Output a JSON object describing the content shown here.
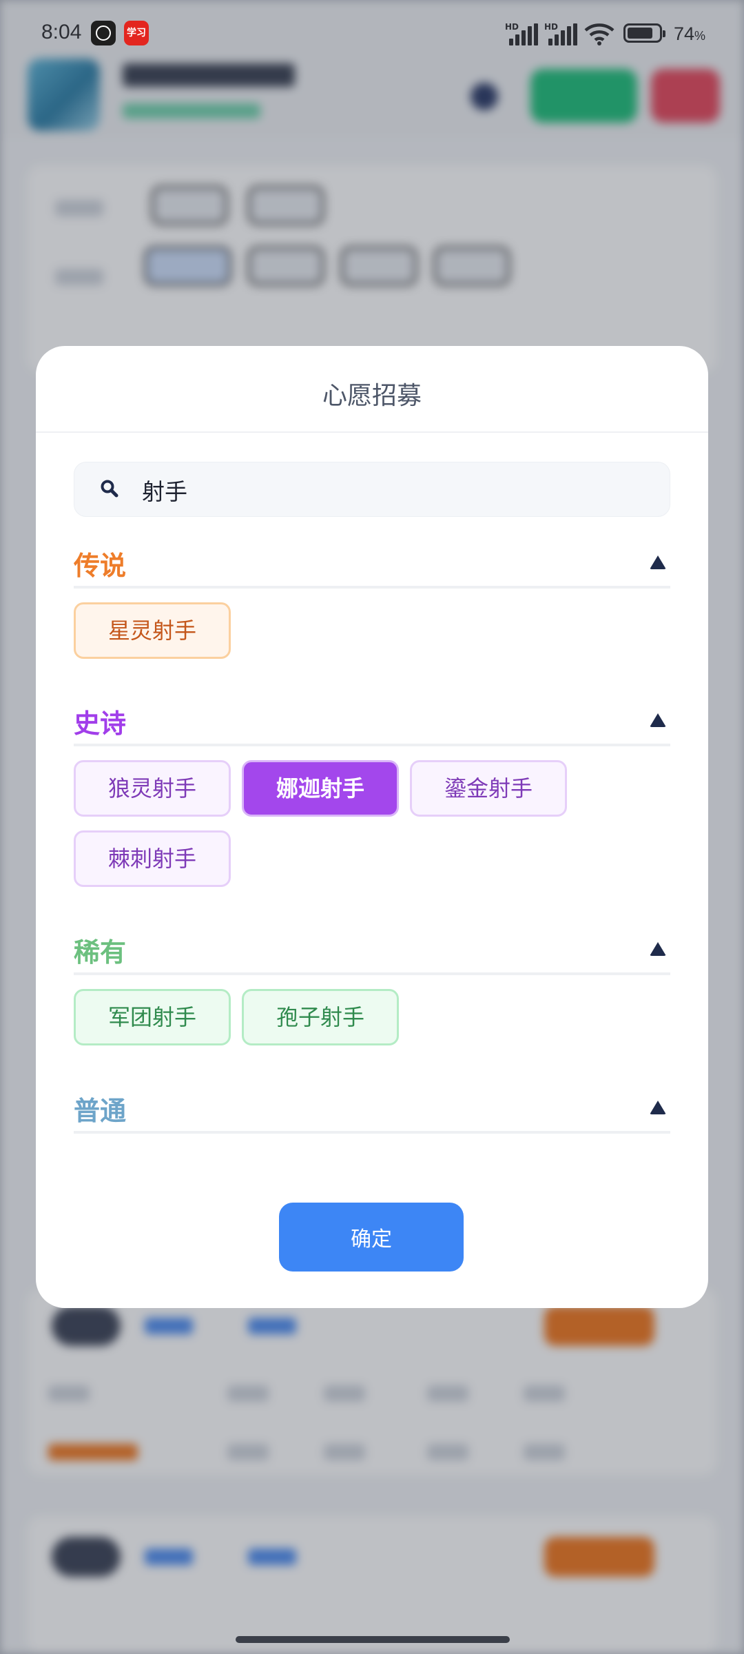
{
  "status_bar": {
    "time": "8:04",
    "red_app_text": "学习",
    "hd_label": "HD",
    "battery": "74",
    "battery_unit": "%"
  },
  "dialog": {
    "title": "心愿招募",
    "search": {
      "value": "射手",
      "placeholder": ""
    },
    "sections": [
      {
        "title": "传说",
        "color": "#ee7d2a",
        "items": [
          "星灵射手"
        ]
      },
      {
        "title": "史诗",
        "color": "#a13eea",
        "items": [
          "狼灵射手",
          "娜迦射手",
          "鎏金射手",
          "棘刺射手"
        ],
        "selected": "娜迦射手"
      },
      {
        "title": "稀有",
        "color": "#6cc07f",
        "items": [
          "军团射手",
          "孢子射手"
        ]
      },
      {
        "title": "普通",
        "color": "#6da4c9",
        "items": []
      }
    ],
    "confirm_label": "确定"
  },
  "colors": {
    "accent": "#3d86f5",
    "selected_chip": "#a347ec"
  }
}
